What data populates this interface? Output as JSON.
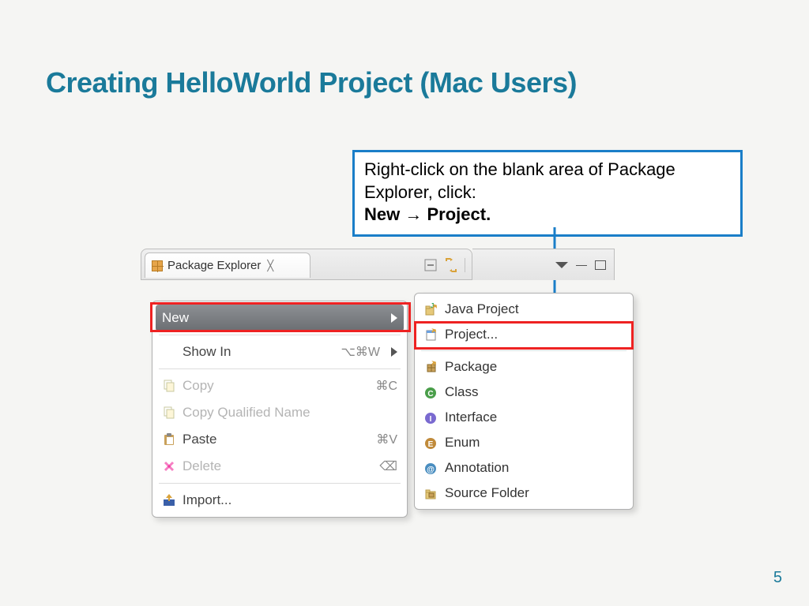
{
  "slide": {
    "title": "Creating HelloWorld Project (Mac Users)",
    "page_number": "5"
  },
  "callout": {
    "line1": "Right-click on the blank area of Package Explorer, click:",
    "bold_new": "New",
    "bold_project": "Project."
  },
  "eclipse": {
    "tab_title": "Package Explorer",
    "context_menu": {
      "new": "New",
      "show_in": "Show In",
      "show_in_shortcut": "⌥⌘W",
      "copy": "Copy",
      "copy_shortcut": "⌘C",
      "copy_qualified": "Copy Qualified Name",
      "paste": "Paste",
      "paste_shortcut": "⌘V",
      "delete": "Delete",
      "delete_shortcut": "⌫",
      "import": "Import..."
    },
    "submenu": {
      "java_project": "Java Project",
      "project": "Project...",
      "package": "Package",
      "class": "Class",
      "interface": "Interface",
      "enum": "Enum",
      "annotation": "Annotation",
      "source_folder": "Source Folder"
    }
  }
}
